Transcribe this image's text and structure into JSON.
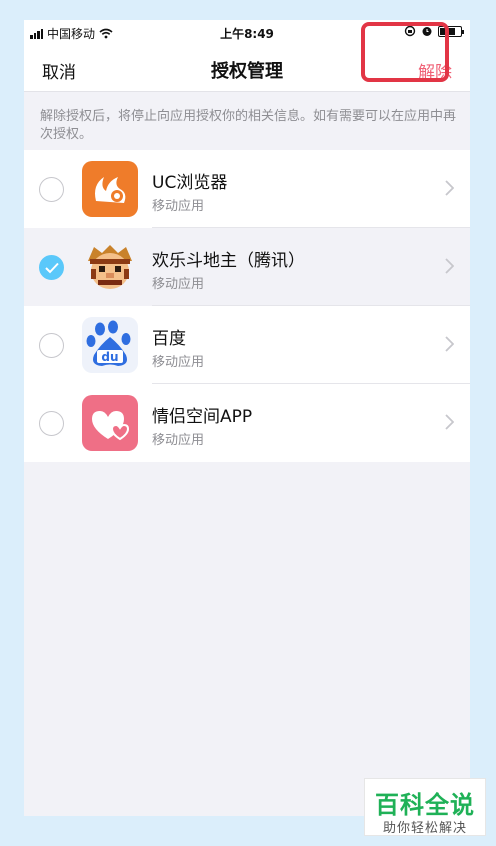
{
  "status_bar": {
    "carrier": "中国移动",
    "time": "上午8:49",
    "signal_icon": "signal-icon",
    "wifi_icon": "wifi-icon",
    "rotation_lock_icon": "rotation-lock-icon",
    "alarm_icon": "alarm-icon",
    "battery_icon": "battery-icon"
  },
  "nav": {
    "cancel_label": "取消",
    "title": "授权管理",
    "revoke_label": "解除"
  },
  "hint": "解除授权后，将停止向应用授权你的相关信息。如有需要可以在应用中再次授权。",
  "apps": [
    {
      "name": "UC浏览器",
      "subtitle": "移动应用",
      "selected": false,
      "icon": "uc-browser-icon"
    },
    {
      "name": "欢乐斗地主（腾讯）",
      "subtitle": "移动应用",
      "selected": true,
      "icon": "doudizhu-icon"
    },
    {
      "name": "百度",
      "subtitle": "移动应用",
      "selected": false,
      "icon": "baidu-icon"
    },
    {
      "name": "情侣空间APP",
      "subtitle": "移动应用",
      "selected": false,
      "icon": "couple-space-icon"
    }
  ],
  "colors": {
    "accent_red": "#f06277",
    "check_blue": "#5ac8fa",
    "highlight_red": "#e23545",
    "watermark_green": "#1fb157"
  },
  "watermark": {
    "title": "百科全说",
    "subtitle": "助你轻松解决"
  }
}
